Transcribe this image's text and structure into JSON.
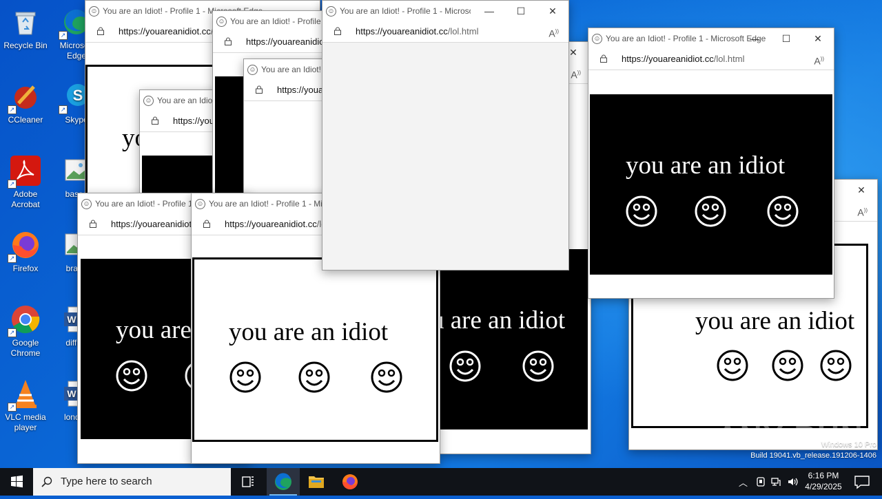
{
  "desktop": {
    "icons": [
      {
        "label": "Recycle Bin"
      },
      {
        "label": "Microsoft Edge"
      },
      {
        "label": "CCleaner"
      },
      {
        "label": "Skype"
      },
      {
        "label": "Adobe Acrobat"
      },
      {
        "label": "based"
      },
      {
        "label": "Firefox"
      },
      {
        "label": "brand"
      },
      {
        "label": "Google Chrome"
      },
      {
        "label": "difficu"
      },
      {
        "label": "VLC media player"
      },
      {
        "label": "london"
      }
    ]
  },
  "popup": {
    "title": "You are an Idiot! - Profile 1 - Microsoft Edge",
    "url_host": "https://youareanidiot.cc",
    "url_path": "/lol.html",
    "message": "you are an idiot",
    "smiley": "☺"
  },
  "watermark": "ANY RUN",
  "os_build": {
    "line1": "Windows 10 Pro",
    "line2": "Build 19041.vb_release.191206-1406"
  },
  "taskbar": {
    "search_placeholder": "Type here to search",
    "time": "6:16 PM",
    "date": "4/29/2025"
  }
}
